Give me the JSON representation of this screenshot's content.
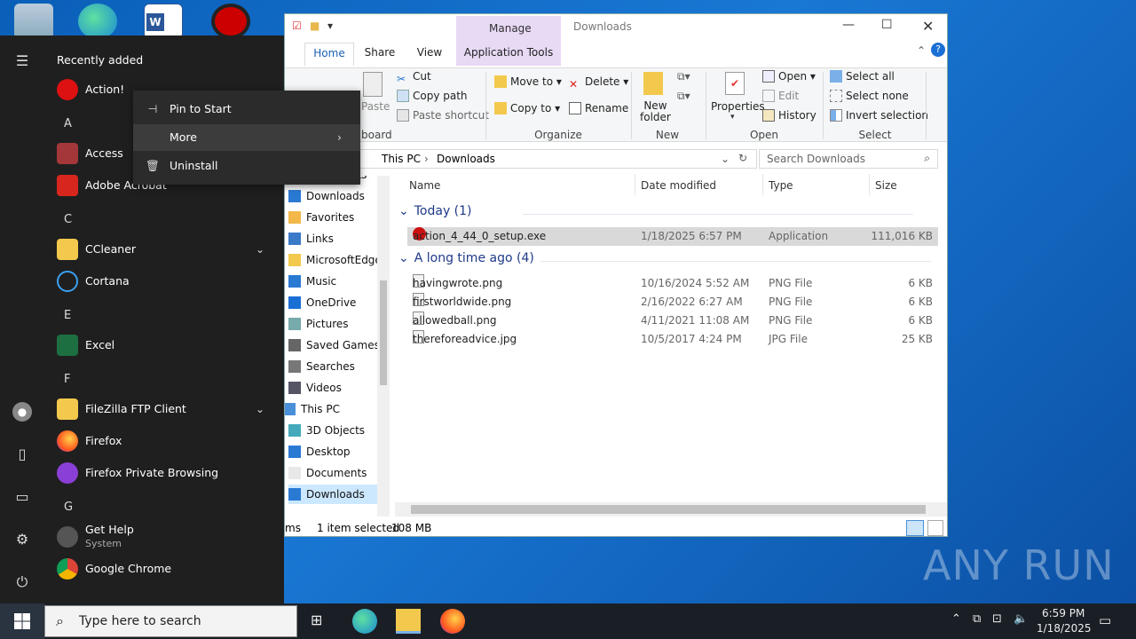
{
  "desktop": {
    "icons": [
      "recycle-bin-icon",
      "edge-icon",
      "word-icon",
      "action-icon"
    ]
  },
  "explorer": {
    "title": "Downloads",
    "context_tab_group": "Manage",
    "tabs": [
      "Home",
      "Share",
      "View",
      "Application Tools"
    ],
    "clipboard": {
      "paste": "Paste",
      "cut": "Cut",
      "copy_path": "Copy path",
      "paste_shortcut": "Paste shortcut",
      "group": "board"
    },
    "organize": {
      "move_to": "Move to",
      "copy_to": "Copy to",
      "delete": "Delete",
      "rename": "Rename",
      "group": "Organize"
    },
    "new": {
      "new_folder_line1": "New",
      "new_folder_line2": "folder",
      "group": "New"
    },
    "open": {
      "properties": "Properties",
      "open": "Open",
      "edit": "Edit",
      "history": "History",
      "group": "Open"
    },
    "select": {
      "select_all": "Select all",
      "select_none": "Select none",
      "invert_selection": "Invert selection",
      "group": "Select"
    },
    "address": {
      "crumb1": "This PC",
      "crumb2": "Downloads"
    },
    "search": {
      "placeholder": "Search Downloads"
    },
    "nav": [
      "Documents",
      "Downloads",
      "Favorites",
      "Links",
      "MicrosoftEdge",
      "Music",
      "OneDrive",
      "Pictures",
      "Saved Games",
      "Searches",
      "Videos",
      "This PC",
      "3D Objects",
      "Desktop",
      "Documents",
      "Downloads"
    ],
    "columns": [
      "Name",
      "Date modified",
      "Type",
      "Size"
    ],
    "groups": [
      {
        "label": "Today (1)",
        "files": [
          {
            "name": "action_4_44_0_setup.exe",
            "date": "1/18/2025 6:57 PM",
            "type": "Application",
            "size": "111,016 KB",
            "selected": true
          }
        ]
      },
      {
        "label": "A long time ago (4)",
        "files": [
          {
            "name": "havingwrote.png",
            "date": "10/16/2024 5:52 AM",
            "type": "PNG File",
            "size": "6 KB"
          },
          {
            "name": "firstworldwide.png",
            "date": "2/16/2022 6:27 AM",
            "type": "PNG File",
            "size": "6 KB"
          },
          {
            "name": "allowedball.png",
            "date": "4/11/2021 11:08 AM",
            "type": "PNG File",
            "size": "6 KB"
          },
          {
            "name": "thereforeadvice.jpg",
            "date": "10/5/2017 4:24 PM",
            "type": "JPG File",
            "size": "25 KB"
          }
        ]
      }
    ],
    "status": {
      "items": "ms",
      "selected": "1 item selected",
      "size": "108 MB"
    }
  },
  "start": {
    "header": "Recently added",
    "recent": "Action!",
    "letters": [
      "A",
      "C",
      "E",
      "F",
      "G"
    ],
    "apps": {
      "access": "Access",
      "acrobat": "Adobe Acrobat",
      "ccleaner": "CCleaner",
      "cortana": "Cortana",
      "excel": "Excel",
      "filezilla": "FileZilla FTP Client",
      "firefox": "Firefox",
      "firefox_private": "Firefox Private Browsing",
      "gethelp": "Get Help",
      "gethelp_sub": "System",
      "chrome": "Google Chrome"
    }
  },
  "context_menu": {
    "pin": "Pin to Start",
    "more": "More",
    "uninstall": "Uninstall"
  },
  "taskbar": {
    "search_placeholder": "Type here to search",
    "time": "6:59 PM",
    "date": "1/18/2025"
  },
  "watermark": "ANY RUN"
}
